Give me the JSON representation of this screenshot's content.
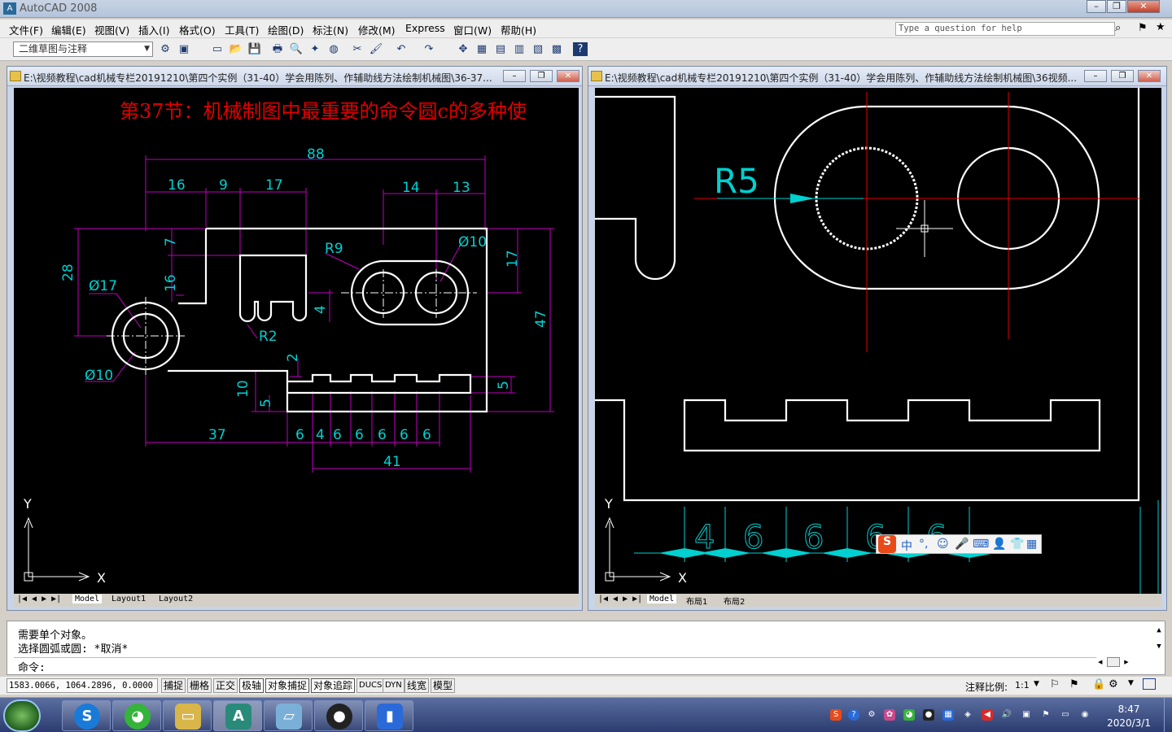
{
  "app": {
    "title": "AutoCAD 2008",
    "icon": "autocad-icon"
  },
  "menubar": [
    "文件(F)",
    "编辑(E)",
    "视图(V)",
    "插入(I)",
    "格式(O)",
    "工具(T)",
    "绘图(D)",
    "标注(N)",
    "修改(M)",
    "Express",
    "窗口(W)",
    "帮助(H)"
  ],
  "help": {
    "placeholder": "Type a question for help"
  },
  "toolbar": {
    "workspace": "二维草图与注释"
  },
  "left_window": {
    "title": "E:\\视频教程\\cad机械专栏20191210\\第四个实例（31-40）学会用陈列、作辅助线方法绘制机械图\\36-37...",
    "heading": "第37节：机械制图中最重要的命令圆c的多种使",
    "dims": {
      "overall": "88",
      "d16": "16",
      "d9": "9",
      "d17a": "17",
      "d14": "14",
      "d13": "13",
      "d28": "28",
      "d7": "7",
      "d16v": "16",
      "dia17": "Ø17",
      "r9": "R9",
      "dia10a": "Ø10",
      "d17v": "17",
      "d4": "4",
      "r2": "R2",
      "d47": "47",
      "d2": "2",
      "dia10b": "Ø10",
      "d10": "10",
      "d5a": "5",
      "d5b": "5",
      "d37": "37",
      "s1": "6",
      "s2": "4",
      "s3": "6",
      "s4": "6",
      "s5": "6",
      "s6": "6",
      "s7": "6",
      "d41": "41"
    },
    "ucs": {
      "x": "X",
      "y": "Y"
    },
    "tabs": [
      "Model",
      "Layout1",
      "Layout2"
    ]
  },
  "right_window": {
    "title": "E:\\视频教程\\cad机械专栏20191210\\第四个实例（31-40）学会用陈列、作辅助线方法绘制机械图\\36视频...",
    "r5": "R5",
    "bottom_dims": [
      "4",
      "6",
      "6",
      "6",
      "6"
    ],
    "ucs": {
      "x": "X",
      "y": "Y"
    },
    "tabs": [
      "Model",
      "布局1",
      "布局2"
    ]
  },
  "command": {
    "lines": [
      "需要单个对象。",
      "选择圆弧或圆: *取消*"
    ],
    "prompt": "命令:"
  },
  "status": {
    "coords": "1583.0066, 1064.2896, 0.0000",
    "buttons": [
      "捕捉",
      "栅格",
      "正交",
      "极轴",
      "对象捕捉",
      "对象追踪",
      "DUCS",
      "DYN",
      "线宽",
      "模型"
    ],
    "annotation_label": "注释比例:",
    "annotation_scale": "1:1"
  },
  "clock": {
    "time": "8:47",
    "date": "2020/3/1"
  },
  "ime": {
    "label": "中"
  }
}
